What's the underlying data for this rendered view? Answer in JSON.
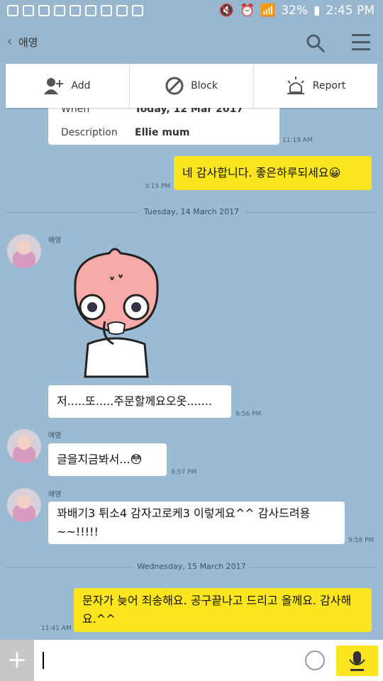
{
  "status": {
    "battery": "32%",
    "time": "2:45 PM"
  },
  "header": {
    "back": "‹",
    "title": "애영"
  },
  "actions": [
    {
      "label": "Add",
      "icon": "add-friend-icon"
    },
    {
      "label": "Block",
      "icon": "block-icon"
    },
    {
      "label": "Report",
      "icon": "report-icon"
    }
  ],
  "card": {
    "when_label": "When",
    "when_value": "Today, 12 Mar 2017",
    "desc_label": "Description",
    "desc_value": "Ellie mum",
    "time": "11:19 AM"
  },
  "messages": [
    {
      "text": "네 감사합니다. 좋은하루되세요😀",
      "time": "3:15 PM"
    },
    {
      "date": "Tuesday, 14 March 2017"
    },
    {
      "sender": "애영",
      "text": "저.....또.....주문할께요오옷.......",
      "time": "9:56 PM"
    },
    {
      "sender": "애영",
      "text": "글을지금봐서...😳",
      "time": "9:57 PM"
    },
    {
      "sender": "애영",
      "text": "꽈배기3 튀소4 감자고로케3 이렇게요^^ 감사드려용~~!!!!!",
      "time": "9:58 PM"
    },
    {
      "date": "Wednesday, 15 March 2017"
    },
    {
      "text": "문자가 늦어 죄송해요. 공구끝나고 드리고 올께요. 감사해요.^^",
      "time": "11:41 AM"
    }
  ]
}
